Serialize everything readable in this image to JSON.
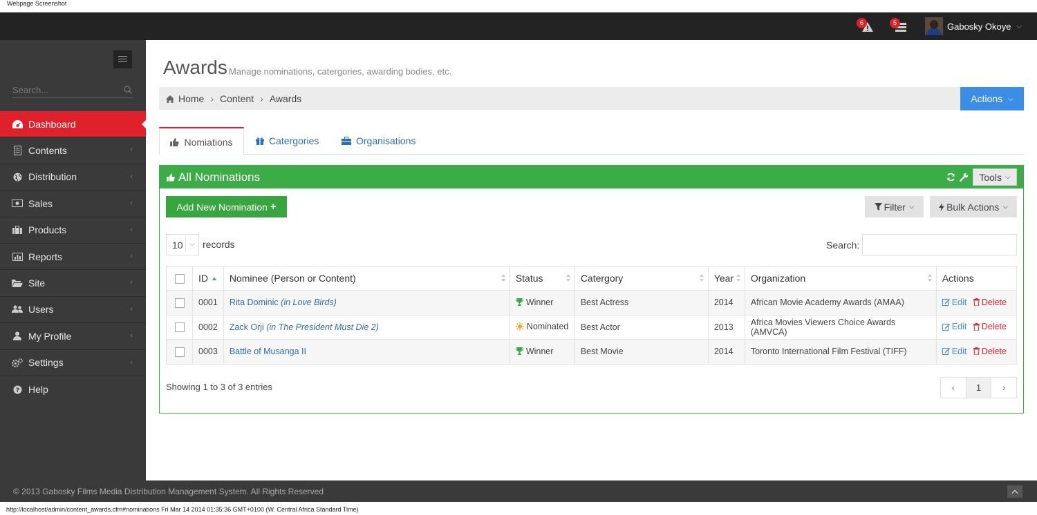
{
  "capture": {
    "label": "Webpage Screenshot",
    "status_line": "http://localhost/admin/content_awards.cfm#nominations Fri Mar 14 2014 01:35:36 GMT+0100 (W. Central Africa Standard Time)"
  },
  "topbar": {
    "notifications": [
      {
        "icon": "alert-icon",
        "count": "6"
      },
      {
        "icon": "messages-icon",
        "count": "5"
      }
    ],
    "user_name": "Gabosky Okoye"
  },
  "sidebar": {
    "search_placeholder": "Search...",
    "items": [
      {
        "label": "Dashboard",
        "icon": "dashboard-icon",
        "active": true
      },
      {
        "label": "Contents",
        "icon": "file-icon"
      },
      {
        "label": "Distribution",
        "icon": "globe-icon"
      },
      {
        "label": "Sales",
        "icon": "money-icon"
      },
      {
        "label": "Products",
        "icon": "briefcase-icon"
      },
      {
        "label": "Reports",
        "icon": "bar-chart-icon"
      },
      {
        "label": "Site",
        "icon": "folder-open-icon"
      },
      {
        "label": "Users",
        "icon": "users-icon"
      },
      {
        "label": "My Profile",
        "icon": "user-icon"
      },
      {
        "label": "Settings",
        "icon": "cogs-icon"
      },
      {
        "label": "Help",
        "icon": "question-icon"
      }
    ]
  },
  "page": {
    "title": "Awards",
    "subtitle": "Manage nominations, catergories, awarding bodies, etc.",
    "breadcrumb": [
      "Home",
      "Content",
      "Awards"
    ],
    "actions_label": "Actions"
  },
  "tabs": [
    {
      "label": "Nomiations",
      "icon": "thumbs-up-icon",
      "active": true
    },
    {
      "label": "Catergories",
      "icon": "gift-icon"
    },
    {
      "label": "Organisations",
      "icon": "briefcase-icon"
    }
  ],
  "panel": {
    "title": "All Nominations",
    "tools_label": "Tools",
    "add_label": "Add New Nomination",
    "filter_label": "Filter",
    "bulk_label": "Bulk Actions",
    "length_value": "10",
    "length_label": "records",
    "search_label": "Search:",
    "columns": [
      "ID",
      "Nominee (Person or Content)",
      "Status",
      "Catergory",
      "Year",
      "Organization",
      "Actions"
    ],
    "rows": [
      {
        "id": "0001",
        "nominee": "Rita Dominic",
        "context": "(in Love Birds)",
        "status": "Winner",
        "status_icon": "trophy-icon",
        "category": "Best Actress",
        "year": "2014",
        "org": "African Movie Academy Awards (AMAA)"
      },
      {
        "id": "0002",
        "nominee": "Zack Orji",
        "context": "(in The President Must Die 2)",
        "status": "Nominated",
        "status_icon": "sun-icon",
        "category": "Best Actor",
        "year": "2013",
        "org": "Africa Movies Viewers Choice Awards (AMVCA)"
      },
      {
        "id": "0003",
        "nominee": "Battle of Musanga II",
        "context": "",
        "status": "Winner",
        "status_icon": "trophy-icon",
        "category": "Best Movie",
        "year": "2014",
        "org": "Toronto International Film Festival (TIFF)"
      }
    ],
    "edit_label": "Edit",
    "delete_label": "Delete",
    "info": "Showing 1 to 3 of 3 entries",
    "pager": {
      "prev": "‹",
      "current": "1",
      "next": "›"
    }
  },
  "footer": {
    "copyright": "© 2013 Gabosky Films Media Distribution Management System. All Rights Reserved"
  },
  "colors": {
    "accent_red": "#e0202b",
    "panel_green": "#3cad46",
    "actions_blue": "#3a8ee6",
    "link_blue": "#2c6fb0"
  }
}
